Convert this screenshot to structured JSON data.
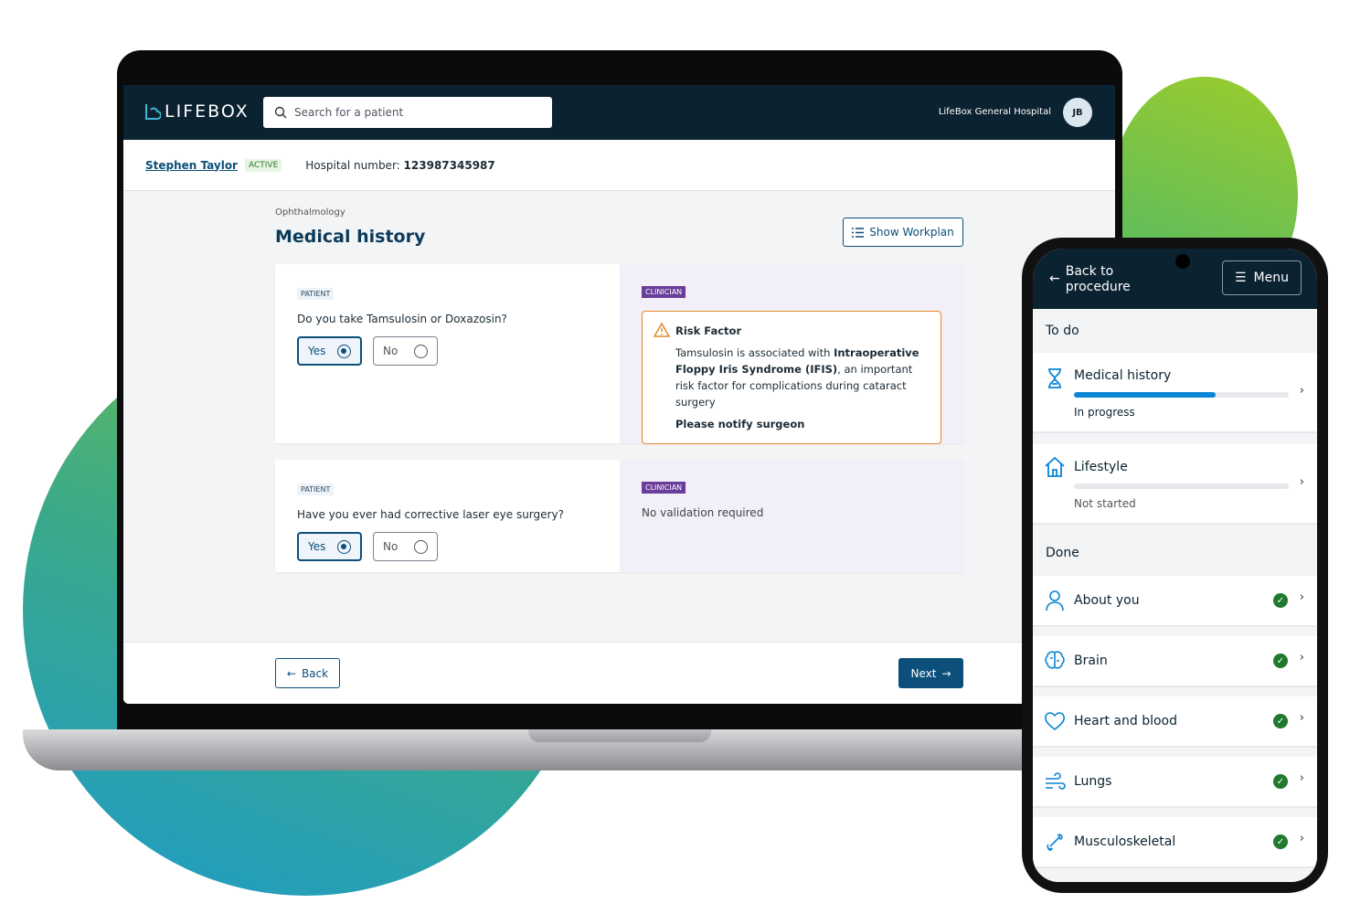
{
  "brand": {
    "logo": "LIFEBOX"
  },
  "header": {
    "search_placeholder": "Search for a patient",
    "hospital": "LifeBox General Hospital",
    "avatar_initials": "JB"
  },
  "patient": {
    "name": "Stephen Taylor",
    "status": "ACTIVE",
    "hospital_number_label": "Hospital number:",
    "hospital_number": "123987345987"
  },
  "page": {
    "breadcrumb": "Ophthalmology",
    "title": "Medical history",
    "workplan_button": "Show Workplan"
  },
  "questions": [
    {
      "tag": "PATIENT",
      "text": "Do you take Tamsulosin or Doxazosin?",
      "yes": "Yes",
      "no": "No",
      "selected": "Yes",
      "clinician_tag": "CLINICIAN",
      "risk": {
        "title": "Risk Factor",
        "pre": "Tamsulosin is associated with ",
        "bold": "Intraoperative Floppy Iris Syndrome (IFIS)",
        "post": ", an important risk factor for complications during cataract surgery",
        "action": "Please notify surgeon"
      }
    },
    {
      "tag": "PATIENT",
      "text": "Have you ever had corrective laser eye surgery?",
      "yes": "Yes",
      "no": "No",
      "selected": "Yes",
      "clinician_tag": "CLINICIAN",
      "clinician_text": "No validation required"
    }
  ],
  "footer": {
    "back": "Back",
    "next": "Next"
  },
  "colors": {
    "header": "#0b2230",
    "primary": "#0b4f7a",
    "clinician": "#6a3d9a",
    "warning": "#e08a2c",
    "progress": "#0a86d4",
    "done": "#1f7a2e"
  },
  "phone": {
    "back": "Back to procedure",
    "menu": "Menu",
    "todo_label": "To do",
    "done_label": "Done",
    "todo": [
      {
        "label": "Medical history",
        "status": "In progress",
        "progress": 66,
        "icon": "hourglass-icon"
      },
      {
        "label": "Lifestyle",
        "status": "Not started",
        "progress": 0,
        "icon": "house-icon"
      }
    ],
    "done": [
      {
        "label": "About you",
        "icon": "person-icon"
      },
      {
        "label": "Brain",
        "icon": "brain-icon"
      },
      {
        "label": "Heart and blood",
        "icon": "heart-icon"
      },
      {
        "label": "Lungs",
        "icon": "wind-icon"
      },
      {
        "label": "Musculoskeletal",
        "icon": "bone-icon"
      }
    ]
  }
}
